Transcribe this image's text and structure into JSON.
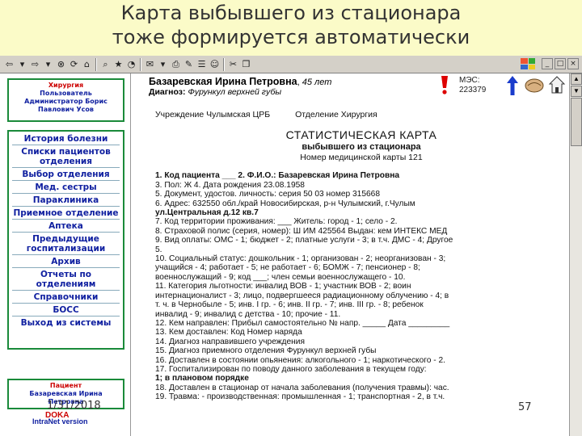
{
  "slide": {
    "title_line1": "Карта выбывшего из стационара",
    "title_line2": "тоже формируется автоматически",
    "date": "1/31/2018",
    "page_number": "57"
  },
  "toolbar": {
    "icons": [
      "back-icon",
      "forward-icon",
      "stop-icon",
      "refresh-icon",
      "home-icon",
      "search-icon",
      "favorites-icon",
      "history-icon",
      "mail-icon",
      "print-icon",
      "edit-icon",
      "discuss-icon",
      "messenger-icon",
      "cut-icon",
      "copy-icon"
    ]
  },
  "sidebar": {
    "dept": "Хирургия",
    "users_label": "Пользователь",
    "user_name": "Администратор Борис",
    "user_name2": "Павлович Усов",
    "menu": [
      "История болезни",
      "Списки пациентов отделения",
      "Выбор отделения",
      "Мед. сестры",
      "Параклиника",
      "Приемное отделение",
      "Аптека",
      "Предыдущие госпитализации",
      "Архив",
      "Отчеты по отделениям",
      "Справочники",
      "БОСС",
      "Выход из системы"
    ],
    "patient_label": "Пациент",
    "patient_name": "Базаревская Ирина",
    "patient_name2": "Петровна",
    "bottom_tag": "DOKA",
    "bottom_version": "IntraNet version"
  },
  "patient": {
    "name": "Базаревская Ирина Петровна",
    "age": "45 лет",
    "diag_label": "Диагноз:",
    "diag": "Фурункул верхней губы",
    "mes_label": "МЭС:",
    "mes_code": "223379"
  },
  "document": {
    "institution": "Учреждение Чулымская ЦРБ",
    "department": "Отделение Хирургия",
    "heading": "СТАТИСТИЧЕСКАЯ КАРТА",
    "sub1": "выбывшего из стационара",
    "sub2": "Номер медицинской карты 121",
    "lines": [
      "1. Код пациента ___ 2. Ф.И.О.: Базаревская Ирина Петровна",
      "3. Пол: Ж      4. Дата рождения 23.08.1958",
      "5. Документ, удостов. личность: серия 50 03 номер 315668",
      "6. Адрес: 632550 обл./край Новосибирская, р-н Чулымский, г.Чулым",
      "ул.Центральная д.12 кв.7",
      "7. Код территории проживания: ___ Житель: город - 1; село - 2.",
      "8. Страховой полис (серия, номер): Ш ИМ 425564   Выдан: кем ИНТЕКС МЕД",
      "9. Вид оплаты: ОМС - 1; бюджет - 2; платные услуги - 3; в т.ч. ДМС - 4; Другое",
      "5.",
      "10. Социальный статус: дошкольник - 1; организован - 2; неорганизован - 3;",
      "учащийся - 4; работает - 5; не работает - 6; БОМЖ - 7; пенсионер - 8;",
      "военнослужащий - 9; код ___; член семьи военнослужащего - 10.",
      "11. Категория льготности: инвалид ВОВ - 1; участник ВОВ - 2; воин",
      "интернационалист - 3; лицо, подвергшееся радиационному облучению - 4; в",
      "т. ч. в Чернобыле - 5; инв. I гр. - 6; инв. II гр. - 7; инв. III гр. - 8; ребенок",
      "инвалид - 9; инвалид с детства - 10; прочие - 11.",
      "12. Кем направлен: Прибыл самостоятельно № напр. _____ Дата _________",
      "13. Кем доставлен:          Код        Номер наряда",
      "14. Диагноз направившего учреждения",
      "15. Диагноз приемного отделения Фурункул верхней губы",
      "16. Доставлен в состоянии опьянения: алкогольного - 1; наркотического - 2.",
      "17. Госпитализирован по поводу данного заболевания в текущем году:",
      "1; в плановом порядке",
      "18. Доставлен в стационар от начала заболевания (получения травмы): час.",
      "19. Травма: - производственная: промышленная - 1; транспортная - 2, в т.ч."
    ]
  }
}
